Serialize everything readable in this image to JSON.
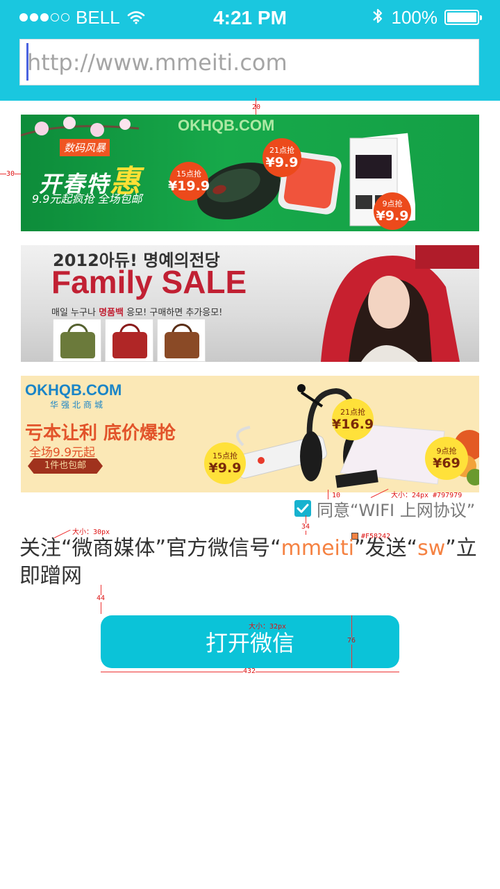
{
  "status_bar": {
    "carrier": "BELL",
    "time": "4:21 PM",
    "battery": "100%",
    "signal_icon": "signal-dots-icon",
    "wifi_icon": "wifi-icon",
    "bluetooth_icon": "bluetooth-icon",
    "battery_icon": "battery-icon"
  },
  "url_bar": {
    "placeholder": "http://www.mmeiti.com",
    "value": ""
  },
  "banners": [
    {
      "logo": "OKHQB.COM",
      "tag": "数码风暴",
      "headline_a": "开春特",
      "headline_b": "惠",
      "sub": "9.9元起疯抢  全场包邮",
      "badges": [
        {
          "label": "15点抢",
          "price": "¥19.9"
        },
        {
          "label": "21点抢",
          "price": "¥9.9"
        },
        {
          "label": "9点抢",
          "price": "¥9.9"
        }
      ]
    },
    {
      "headline_top": "2012아듀! 명예의전당",
      "headline_main": "Family SALE",
      "sub_a": "매일 누구나 ",
      "sub_hl": "명품백",
      "sub_b": " 응모! 구매하면 추가응모!"
    },
    {
      "logo": "OKHQB.COM",
      "sub_logo": "华强北商城",
      "headline": "亏本让利 底价爆抢",
      "line": "全场9.9元起",
      "tag": "1件也包邮",
      "badges": [
        {
          "label": "15点抢",
          "price": "¥9.9"
        },
        {
          "label": "21点抢",
          "price": "¥16.9"
        },
        {
          "label": "9点抢",
          "price": "¥69"
        }
      ]
    }
  ],
  "agreement": {
    "checked": true,
    "text": "同意“WIFI 上网协议”"
  },
  "message": {
    "part1": "关注“微商媒体”官方微信号“",
    "account": "mmeiti",
    "part2": "”发送“",
    "keyword": "sw",
    "part3": "”立即蹭网"
  },
  "open_button": {
    "label": "打开微信"
  },
  "annotations": {
    "gap_top": "20",
    "side_margin": "30",
    "gap_checkbox": "10",
    "gap_text": "34",
    "font_text": "大小：30px",
    "color_highlight": "#F58242",
    "font_agree": "大小：24px #797979",
    "gap_button": "44",
    "font_button": "大小：32px",
    "button_height": "76",
    "button_width": "432"
  },
  "colors": {
    "header": "#1ac7df",
    "button": "#0bc3d8",
    "highlight": "#f58242",
    "agree_text": "#797979"
  }
}
